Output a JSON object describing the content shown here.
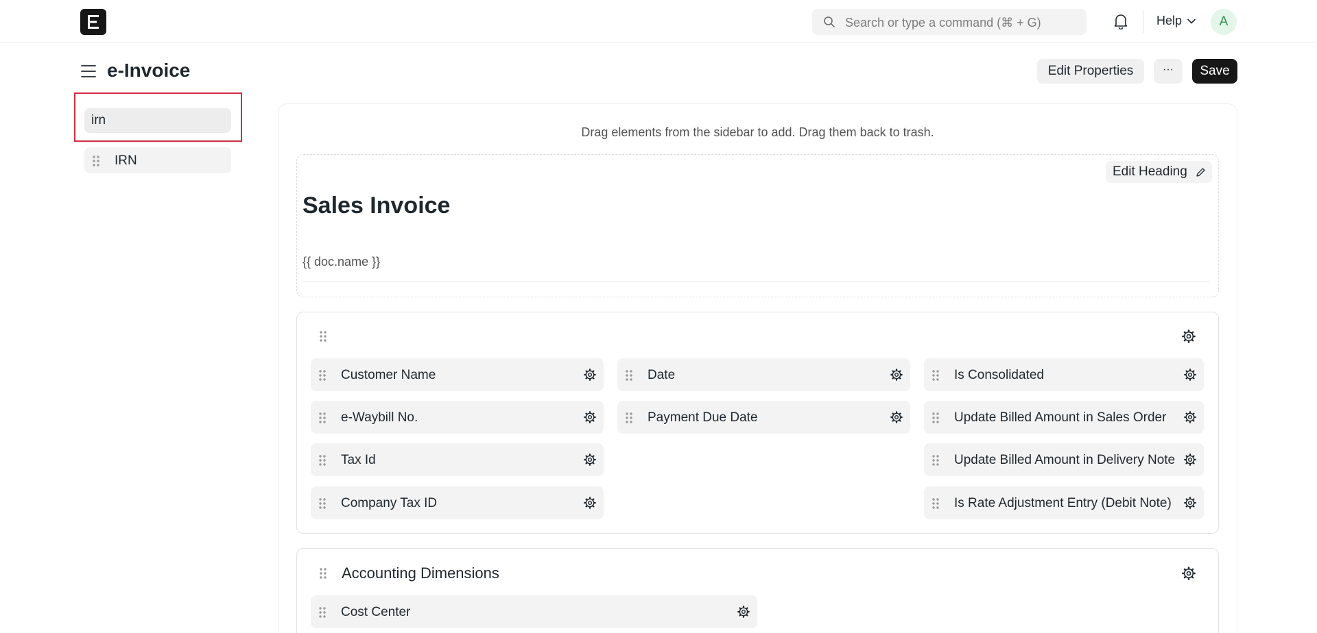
{
  "navbar": {
    "search_placeholder": "Search or type a command (⌘ + G)",
    "help_label": "Help",
    "avatar_initial": "A"
  },
  "page": {
    "title": "e-Invoice",
    "edit_properties_label": "Edit Properties",
    "more_label": "···",
    "save_label": "Save"
  },
  "sidebar": {
    "search_value": "irn",
    "fields": [
      {
        "label": "IRN"
      }
    ]
  },
  "canvas": {
    "hint": "Drag elements from the sidebar to add. Drag them back to trash.",
    "heading": {
      "edit_label": "Edit Heading",
      "title": "Sales Invoice",
      "subtitle": "{{ doc.name }}"
    },
    "section1": {
      "fields": [
        {
          "label": "Customer Name"
        },
        {
          "label": "e-Waybill No."
        },
        {
          "label": "Tax Id"
        },
        {
          "label": "Company Tax ID"
        },
        {
          "label": "Date"
        },
        {
          "label": "Payment Due Date"
        },
        {
          "label": "Is Consolidated"
        },
        {
          "label": "Update Billed Amount in Sales Order"
        },
        {
          "label": "Update Billed Amount in Delivery Note"
        },
        {
          "label": "Is Rate Adjustment Entry (Debit Note)"
        }
      ]
    },
    "section2": {
      "title": "Accounting Dimensions",
      "fields": [
        {
          "label": "Cost Center"
        }
      ]
    }
  },
  "colors": {
    "primary_button": "#171717",
    "highlight_border": "#d12c40",
    "field_background": "#f3f3f3"
  }
}
